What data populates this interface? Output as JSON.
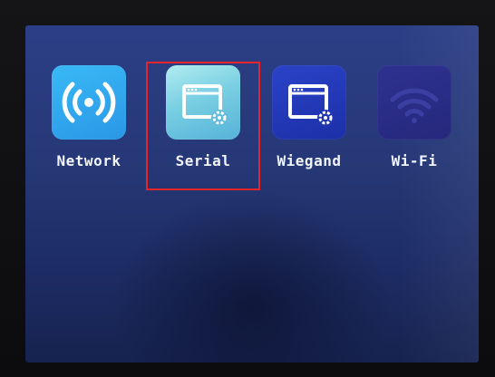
{
  "menu": {
    "apps": [
      {
        "id": "network",
        "label": "Network",
        "icon": "wireless-signal-icon",
        "selected": false
      },
      {
        "id": "serial",
        "label": "Serial",
        "icon": "window-settings-icon",
        "selected": true
      },
      {
        "id": "wiegand",
        "label": "Wiegand",
        "icon": "window-settings-icon",
        "selected": false
      },
      {
        "id": "wifi",
        "label": "Wi-Fi",
        "icon": "wifi-icon",
        "selected": false
      }
    ]
  },
  "colors": {
    "screen_top": "#2c3f86",
    "screen_bottom": "#16224f",
    "selection_outline": "#e5252a",
    "label_text": "#f2f4fb"
  }
}
